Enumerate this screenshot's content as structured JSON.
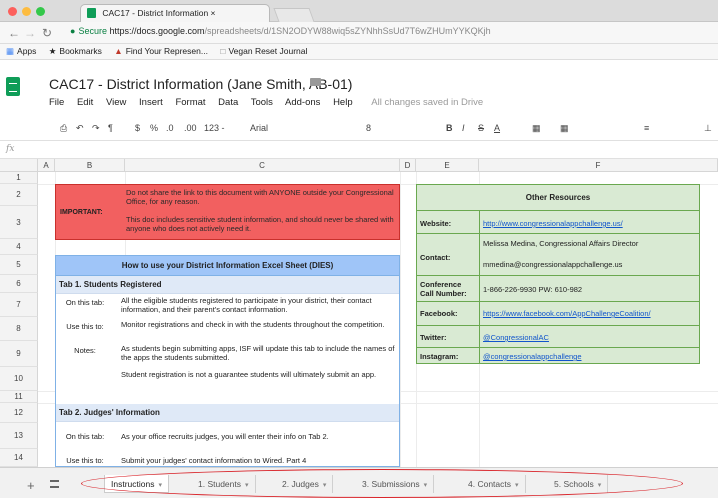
{
  "browser": {
    "tab_title": "CAC17 - District Information ×",
    "url_secure": "Secure",
    "url_host": "https://docs.google.com",
    "url_path": "/spreadsheets/d/1SN2ODYW88wiq5sZYNhhSsUd7T6wZHUmYYKQKjh",
    "bookmarks": [
      {
        "icon": "apps-icon",
        "label": "Apps"
      },
      {
        "icon": "star-icon",
        "label": "Bookmarks"
      },
      {
        "icon": "house-icon",
        "label": "Find Your Represen..."
      },
      {
        "icon": "page-icon",
        "label": "Vegan Reset Journal"
      }
    ]
  },
  "doc": {
    "title": "CAC17 - District Information (Jane Smith, AB-01)",
    "menus": [
      "File",
      "Edit",
      "View",
      "Insert",
      "Format",
      "Data",
      "Tools",
      "Add-ons",
      "Help"
    ],
    "saved_status": "All changes saved in Drive"
  },
  "toolbar": {
    "zoom": "123 -",
    "font": "Arial",
    "font_size": "8"
  },
  "grid": {
    "columns": [
      "A",
      "B",
      "C",
      "D",
      "E",
      "F"
    ],
    "rows": [
      "1",
      "2",
      "3",
      "4",
      "5",
      "6",
      "7",
      "8",
      "9",
      "10",
      "11",
      "12",
      "13",
      "14"
    ]
  },
  "important_box": {
    "label": "IMPORTANT:",
    "line1": "Do not share the link to this document with ANYONE outside your Congressional Office, for any reason.",
    "line2": "This doc includes sensitive student information, and should never be shared with anyone who does not actively need it."
  },
  "howto": {
    "title": "How to use your District Information Excel Sheet (DIES)",
    "tab1_title": "Tab 1. Students Registered",
    "tab1_rows": [
      {
        "label": "On this tab:",
        "text": "All the eligible students registered to participate in your district, their contact information, and their parent's contact information."
      },
      {
        "label": "Use this to:",
        "text": "Monitor registrations and check in with the students throughout the competition."
      },
      {
        "label": "Notes:",
        "text": "As students begin submitting apps, ISF will update this tab to include the names of the apps the students submitted."
      },
      {
        "label": "",
        "text": "Student registration is not a guarantee students will ultimately submit an app."
      }
    ],
    "tab2_title": "Tab 2. Judges' Information",
    "tab2_rows": [
      {
        "label": "On this tab:",
        "text": "As your office recruits judges, you will enter their info on Tab 2."
      },
      {
        "label": "Use this to:",
        "text": "Submit your judges' contact information to Wired. Part 4"
      }
    ]
  },
  "resources": {
    "title": "Other Resources",
    "website_label": "Website:",
    "website_value": "http://www.congressionalappchallenge.us/",
    "contact_label": "Contact:",
    "contact_name": "Melissa Medina, Congressional Affairs Director",
    "contact_email": "mmedina@congressionalappchallenge.us",
    "conf_label": "Conference Call Number:",
    "conf_value": "1-866-226-9930     PW: 610-982",
    "facebook_label": "Facebook:",
    "facebook_value": "https://www.facebook.com/AppChallengeCoalition/",
    "twitter_label": "Twitter:",
    "twitter_value": "@CongressionalAC",
    "instagram_label": "Instagram:",
    "instagram_value": "@congressionalappchallenge"
  },
  "sheet_tabs": [
    {
      "label": "Instructions",
      "active": true
    },
    {
      "label": "1. Students",
      "active": false
    },
    {
      "label": "2. Judges",
      "active": false
    },
    {
      "label": "3. Submissions",
      "active": false
    },
    {
      "label": "4. Contacts",
      "active": false
    },
    {
      "label": "5. Schools",
      "active": false
    }
  ],
  "colors": {
    "sheets_green": "#0f9d58",
    "important_red": "#f26060",
    "howto_blue": "#9fc5f8",
    "resources_green": "#d9ead3",
    "annotation_red": "#d9252b"
  }
}
